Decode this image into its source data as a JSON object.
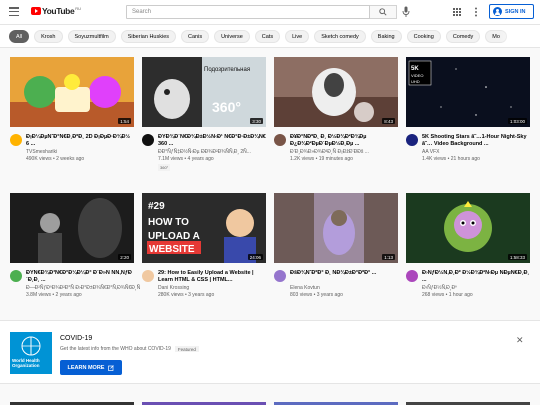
{
  "header": {
    "logo_text": "YouTube",
    "logo_sup": "RU",
    "search_placeholder": "Search",
    "signin_label": "SIGN IN"
  },
  "chips": [
    "All",
    "Krosh",
    "Soyuzmultfilm",
    "Siberian Huskies",
    "Canis",
    "Universe",
    "Cats",
    "Live",
    "Sketch comedy",
    "Baking",
    "Cooking",
    "Comedy",
    "Mo"
  ],
  "videos": [
    {
      "title": "Ð¡Ð¼ÐµÑˆÐ°Ñ€Ð¸ÐºÐ¸ 2D Ð¡ÐµÐ·Ð¾Ð½ 6 ...",
      "channel": "TVSmeshariki",
      "stats": "490K views • 2 weeks ago",
      "duration": "1:54"
    },
    {
      "title": "ÐŸÐ¾Ð´Ñ€Ð¾Ð±Ð½Ñ‹Ð¹ Ñ€Ð°Ð·Ð±Ð¾Ñ€ 360 ...",
      "channel": "ÐÐ°ÑƒÑ‡Ð½Ñ‹Ðµ ÐÐ¾Ð²Ð¾ÑÑ‚Ð¸ 2Ñ...",
      "stats": "7.1M views • 4 years ago",
      "badge": "360°",
      "duration": "3:30"
    },
    {
      "title": "Ð¥Ð°ÑÐºÐ¸ Ð¸ Ð½Ð¾Ð²Ð¾Ðµ Ð¿Ð¾Ð²ÐµÐ´ÐµÐ½Ð¸Ðµ ...",
      "channel": "Ð‘Ð¸Ð¾Ð»Ð¾Ð³Ð¸Ñ Ð¡ÐžÐ‘ÐÐš ...",
      "stats": "1.2K views • 19 minutes ago",
      "duration": "8:43"
    },
    {
      "title": "5K Shooting Stars â˜…1-Hour Night-Sky â˜… Video Background ...",
      "channel": "AA VFX",
      "stats": "1.4K views • 21 hours ago",
      "duration": "1:03:00"
    },
    {
      "title": "ÐŸÑ€Ð¾Ð³Ñ€Ð°Ð¼Ð¼Ð° Ð´Ð»Ñ ÑÑ‚ÑƒÐ´Ð¸Ð¸ ...",
      "channel": "Ð—Ð²ÑƒÐºÐ¾Ð²Ð°Ñ Ð›Ð°Ð±Ð¾Ñ€Ð°Ñ‚Ð¾Ñ€Ð¸Ñ",
      "stats": "3.8M views • 2 years ago",
      "duration": "2:20"
    },
    {
      "title": "29: How to Easily Upload a Website | Learn HTML & CSS | HTML...",
      "channel": "Dani Krossing",
      "stats": "280K views • 3 years ago",
      "duration": "24:06"
    },
    {
      "title": "ÐšÐ¾ÑˆÐºÐ° Ð¸ ÑÐ¾Ð±Ð°ÐºÐ° ...",
      "channel": "Elena Kovtun",
      "stats": "803 views • 3 years ago",
      "duration": "1:13"
    },
    {
      "title": "Ð›ÑƒÐ½Ñ‚Ð¸Ðº Ð½Ð¾Ð²Ñ‹Ðµ ÑÐµÑ€Ð¸Ð¸ ...",
      "channel": "Ð›ÑƒÐ½Ñ‚Ð¸Ðº",
      "stats": "268 views • 1 hour ago",
      "duration": "1:58:33"
    }
  ],
  "covid": {
    "title": "COVID-19",
    "subtitle": "Get the latest info from the WHO about COVID-19",
    "featured": "Featured",
    "button": "LEARN MORE",
    "logo_line1": "World Health",
    "logo_line2": "Organization"
  }
}
